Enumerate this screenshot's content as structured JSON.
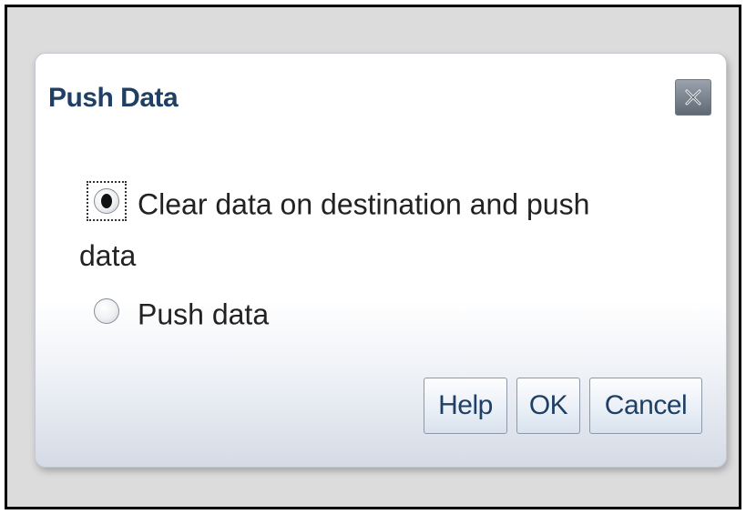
{
  "dialog": {
    "title": "Push Data",
    "close_icon": "close-icon"
  },
  "options": [
    {
      "label_line1": "Clear data on destination and push",
      "label_line2": "data",
      "selected": true
    },
    {
      "label": "Push data",
      "selected": false
    }
  ],
  "buttons": {
    "help": "Help",
    "ok": "OK",
    "cancel": "Cancel"
  },
  "colors": {
    "title": "#1f3f64",
    "background": "#dcdcdc"
  }
}
